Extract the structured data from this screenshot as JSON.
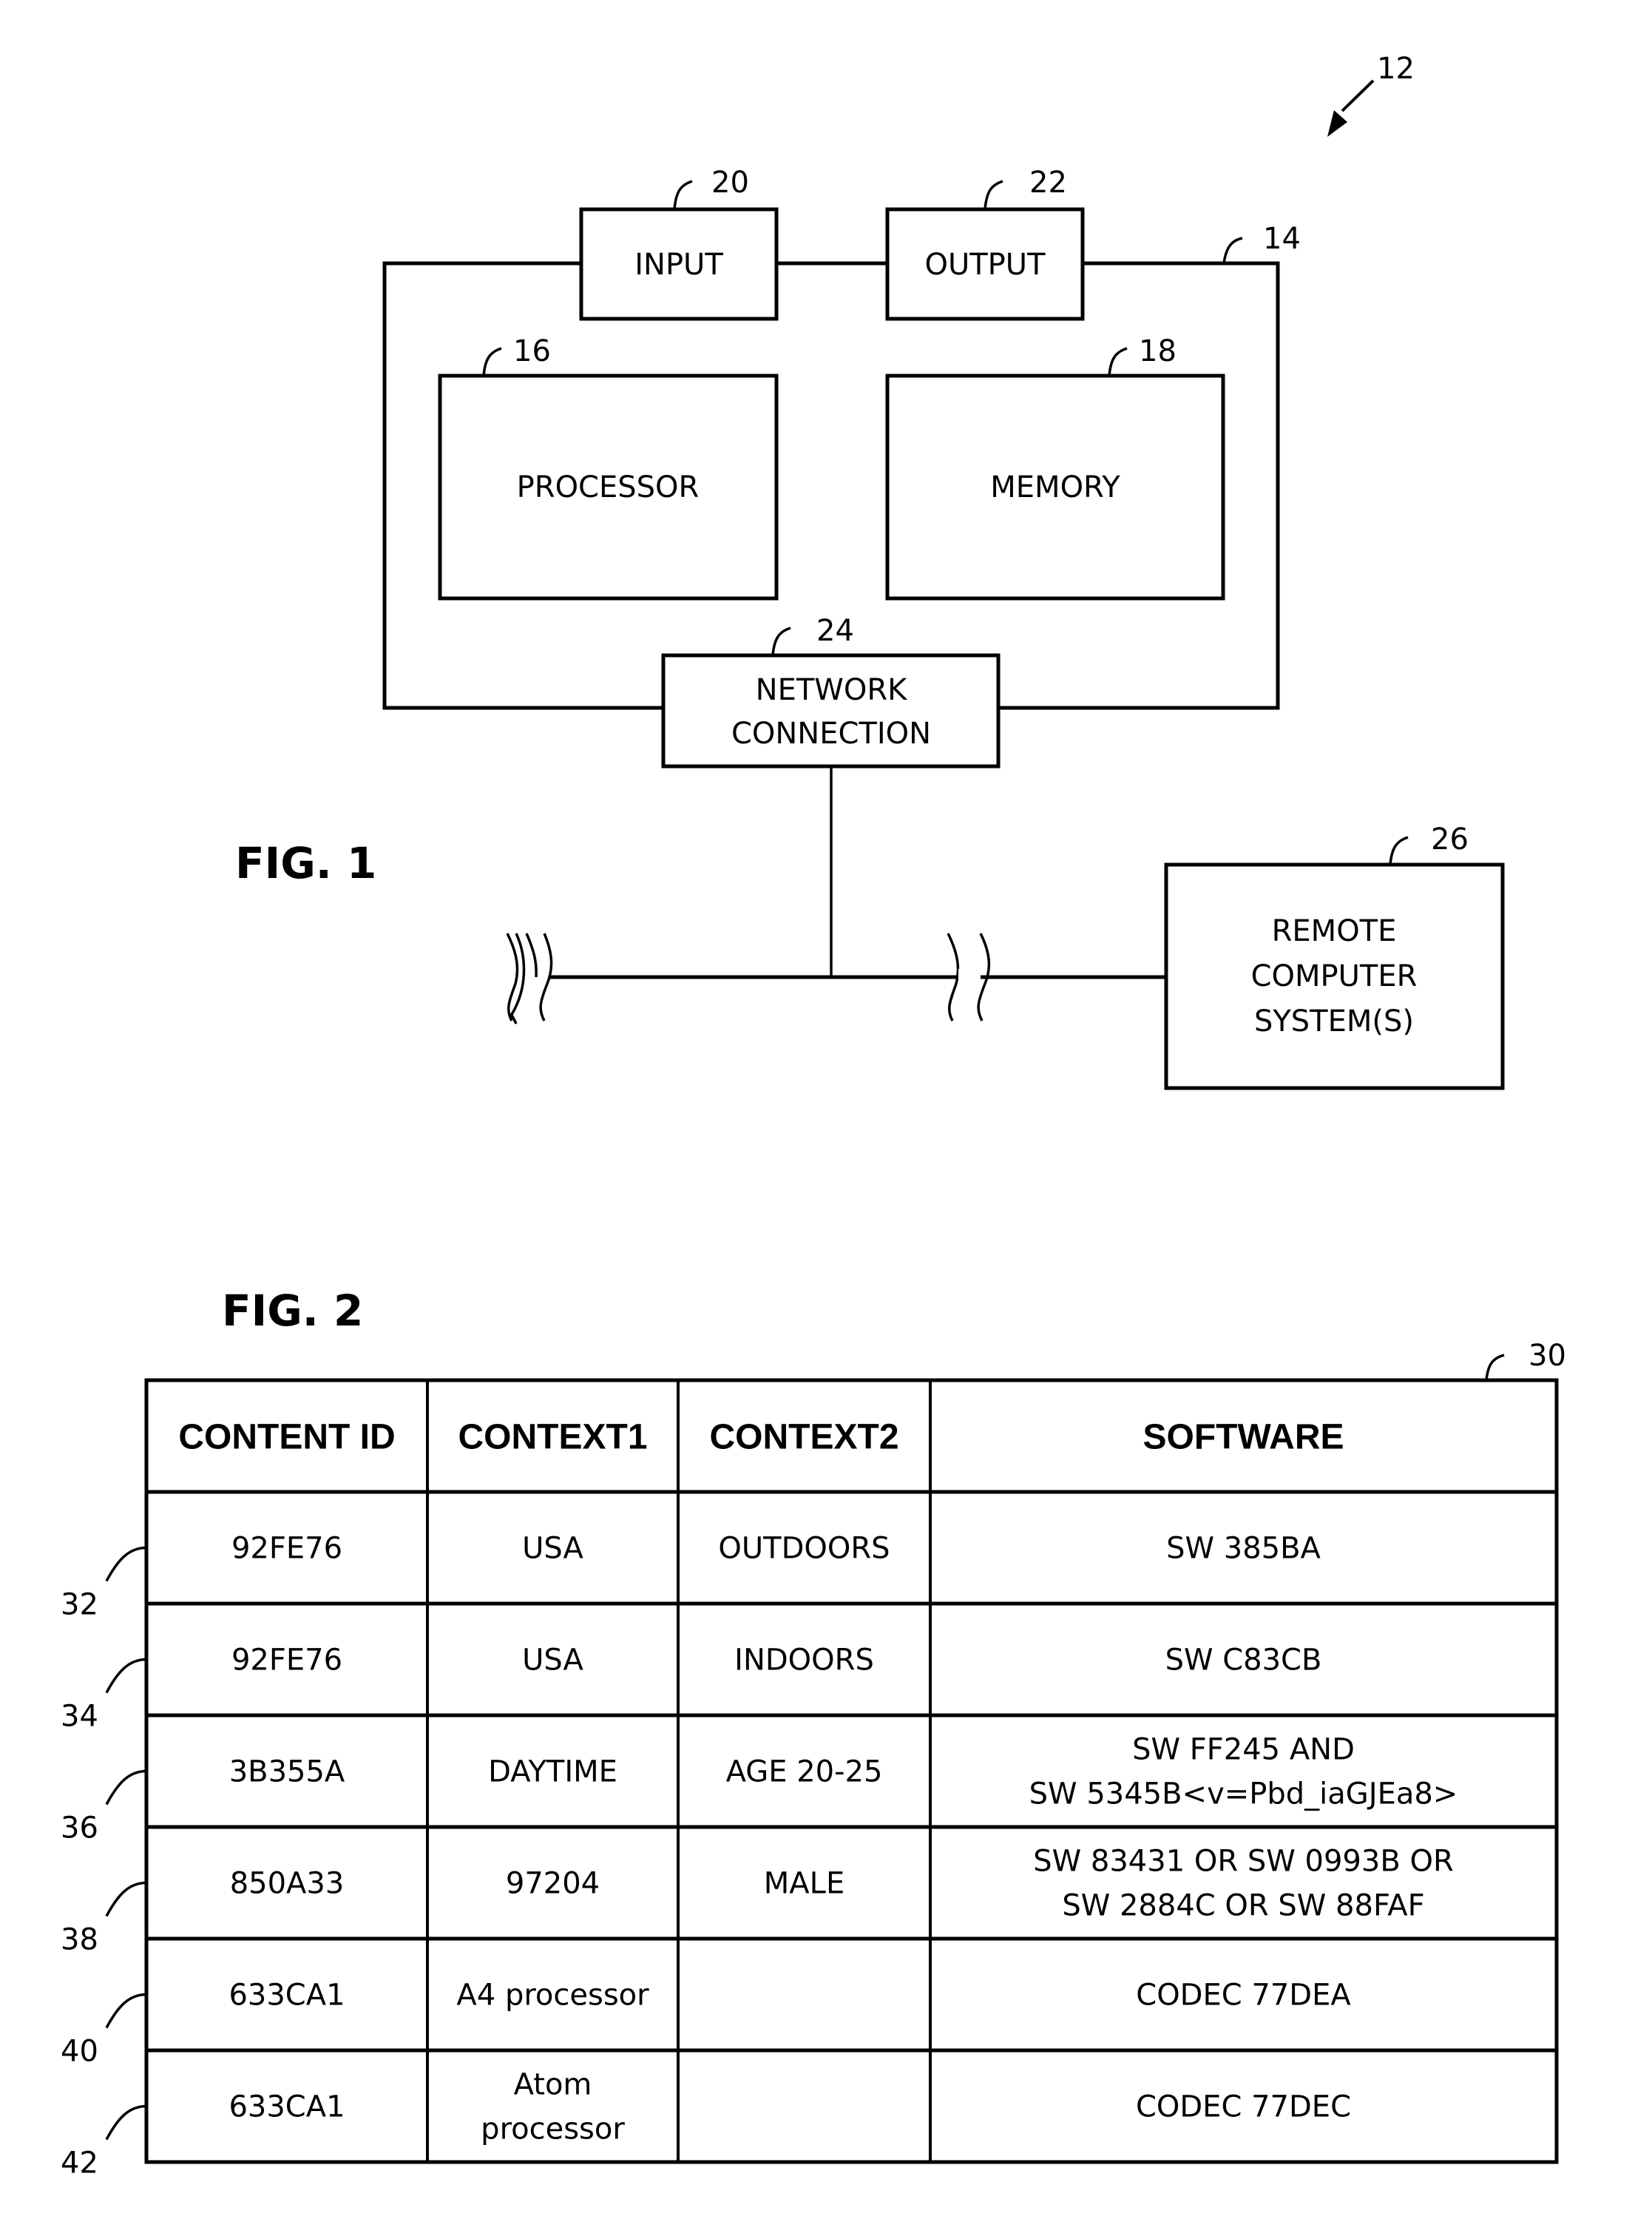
{
  "fig1": {
    "title": "FIG. 1",
    "system_ref": "12",
    "frame_ref": "14",
    "blocks": {
      "input": {
        "label": "INPUT",
        "ref": "20"
      },
      "output": {
        "label": "OUTPUT",
        "ref": "22"
      },
      "processor": {
        "label": "PROCESSOR",
        "ref": "16"
      },
      "memory": {
        "label": "MEMORY",
        "ref": "18"
      },
      "network": {
        "label_line1": "NETWORK",
        "label_line2": "CONNECTION",
        "ref": "24"
      },
      "remote": {
        "label_line1": "REMOTE",
        "label_line2": "COMPUTER",
        "label_line3": "SYSTEM(S)",
        "ref": "26"
      }
    }
  },
  "fig2": {
    "title": "FIG. 2",
    "table_ref": "30",
    "columns": [
      "CONTENT ID",
      "CONTEXT1",
      "CONTEXT2",
      "SOFTWARE"
    ],
    "rows": [
      {
        "ref": "32",
        "content_id": "92FE76",
        "context1": [
          "USA"
        ],
        "context2": [
          "OUTDOORS"
        ],
        "software": [
          "SW 385BA"
        ]
      },
      {
        "ref": "34",
        "content_id": "92FE76",
        "context1": [
          "USA"
        ],
        "context2": [
          "INDOORS"
        ],
        "software": [
          "SW C83CB"
        ]
      },
      {
        "ref": "36",
        "content_id": "3B355A",
        "context1": [
          "DAYTIME"
        ],
        "context2": [
          "AGE 20-25"
        ],
        "software": [
          "SW FF245 AND",
          "SW 5345B<v=Pbd_iaGJEa8>"
        ]
      },
      {
        "ref": "38",
        "content_id": "850A33",
        "context1": [
          "97204"
        ],
        "context2": [
          "MALE"
        ],
        "software": [
          "SW 83431 OR SW 0993B OR",
          "SW 2884C OR SW 88FAF"
        ]
      },
      {
        "ref": "40",
        "content_id": "633CA1",
        "context1": [
          "A4 processor"
        ],
        "context2": [],
        "software": [
          "CODEC 77DEA"
        ]
      },
      {
        "ref": "42",
        "content_id": "633CA1",
        "context1": [
          "Atom",
          "processor"
        ],
        "context2": [],
        "software": [
          "CODEC 77DEC"
        ]
      }
    ]
  }
}
